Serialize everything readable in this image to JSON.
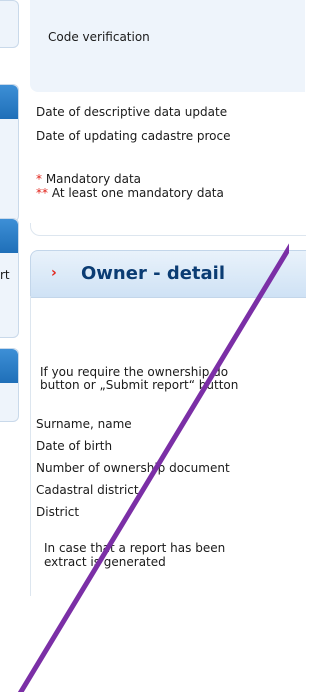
{
  "top_card": {
    "code_verification_label": "Code verification",
    "date_descriptive_label": "Date of descriptive data update",
    "date_cadastre_label": "Date of updating cadastre proce",
    "mandatory_star": "*",
    "mandatory_text": " Mandatory data",
    "at_least_one_star": "**",
    "at_least_one_text": " At least one mandatory data"
  },
  "sidebar": {
    "fragment_text": "rt"
  },
  "owner_detail": {
    "title": "Owner - detail",
    "arrow": "›",
    "info_line1": "If you require the ownership do",
    "info_line2": "button or „Submit report“ button",
    "fields": [
      "Surname, name",
      "Date of birth",
      "Number of ownership document",
      "Cadastral district",
      "District"
    ],
    "report_line1": "In case that a report has been",
    "report_line2": "extract is generated"
  },
  "colors": {
    "accent_blue": "#1f6fb8",
    "title_blue": "#0b3c73",
    "required_red": "#e2231a",
    "annotation_purple": "#7b2fa6"
  }
}
